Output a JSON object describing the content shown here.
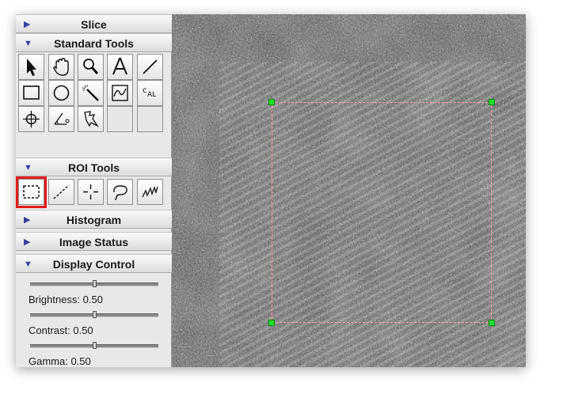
{
  "panels": {
    "slice": {
      "label": "Slice",
      "expanded": false
    },
    "standard_tools": {
      "label": "Standard Tools",
      "expanded": true
    },
    "roi_tools": {
      "label": "ROI Tools",
      "expanded": true
    },
    "histogram": {
      "label": "Histogram",
      "expanded": false
    },
    "image_status": {
      "label": "Image Status",
      "expanded": false
    },
    "display_control": {
      "label": "Display Control",
      "expanded": true
    }
  },
  "standard_tools": [
    "arrow-select-icon",
    "hand-pan-icon",
    "magnifier-zoom-icon",
    "text-tool-icon",
    "line-tool-icon",
    "rectangle-tool-icon",
    "oval-tool-icon",
    "magic-wand-icon",
    "profile-tool-icon",
    "calibrate-icon",
    "crosshair-tool-icon",
    "angle-tool-icon",
    "lasso-select-icon"
  ],
  "roi_tools": {
    "selected": "rectangle-roi-icon",
    "items": [
      "rectangle-roi-icon",
      "line-roi-icon",
      "point-roi-icon",
      "freehand-roi-icon",
      "polyline-roi-icon"
    ]
  },
  "display_control": {
    "brightness": {
      "label": "Brightness: 0.50",
      "value": 0.5
    },
    "contrast": {
      "label": "Contrast: 0.50",
      "value": 0.5
    },
    "gamma": {
      "label": "Gamma: 0.50",
      "value": 0.5
    }
  },
  "colors": {
    "highlight": "#e11b1b",
    "roi_outline": "#e01818",
    "roi_handle": "#1fe02a",
    "expander_triangle": "#3a3f9c"
  }
}
